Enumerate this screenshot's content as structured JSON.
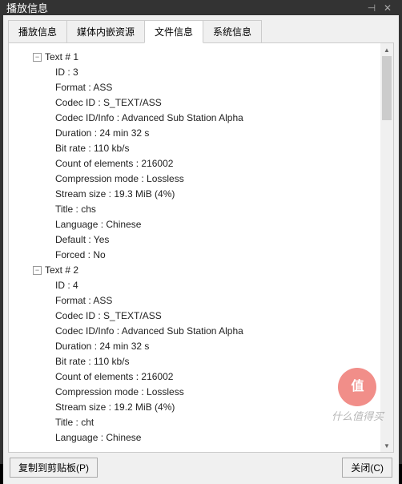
{
  "window": {
    "title": "播放信息"
  },
  "tabs": {
    "items": [
      {
        "label": "播放信息"
      },
      {
        "label": "媒体内嵌资源"
      },
      {
        "label": "文件信息"
      },
      {
        "label": "系统信息"
      }
    ],
    "activeIndex": 2
  },
  "tree": {
    "groups": [
      {
        "label": "Text # 1",
        "props": [
          "ID : 3",
          "Format : ASS",
          "Codec ID : S_TEXT/ASS",
          "Codec ID/Info : Advanced Sub Station Alpha",
          "Duration : 24 min 32 s",
          "Bit rate : 110 kb/s",
          "Count of elements : 216002",
          "Compression mode : Lossless",
          "Stream size : 19.3 MiB (4%)",
          "Title : chs",
          "Language : Chinese",
          "Default : Yes",
          "Forced : No"
        ]
      },
      {
        "label": "Text # 2",
        "props": [
          "ID : 4",
          "Format : ASS",
          "Codec ID : S_TEXT/ASS",
          "Codec ID/Info : Advanced Sub Station Alpha",
          "Duration : 24 min 32 s",
          "Bit rate : 110 kb/s",
          "Count of elements : 216002",
          "Compression mode : Lossless",
          "Stream size : 19.2 MiB (4%)",
          "Title : cht",
          "Language : Chinese"
        ]
      }
    ]
  },
  "buttons": {
    "copy": "复制到剪贴板(P)",
    "close": "关闭(C)"
  },
  "watermark": {
    "badge": "值",
    "text": "什么值得买"
  }
}
